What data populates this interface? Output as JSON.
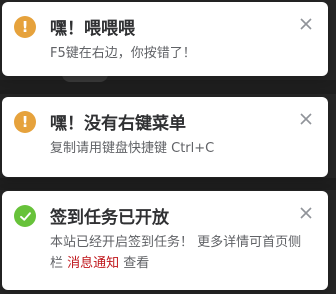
{
  "colors": {
    "warning": "#e6a23c",
    "success": "#67c23a",
    "link": "#c0161b",
    "title": "#303133",
    "text": "#606266",
    "close": "#909399"
  },
  "notifications": [
    {
      "type": "warning",
      "icon": "exclamation-icon",
      "title": "嘿！喂喂喂",
      "message": "F5键在右边，你按错了！"
    },
    {
      "type": "warning",
      "icon": "exclamation-icon",
      "title": "嘿！没有右键菜单",
      "message": "复制请用键盘快捷键 Ctrl+C"
    },
    {
      "type": "success",
      "icon": "check-icon",
      "title": "签到任务已开放",
      "message_before": "本站已经开启签到任务！ 更多详情可首页侧栏 ",
      "message_link": "消息通知",
      "message_after": " 查看"
    }
  ]
}
